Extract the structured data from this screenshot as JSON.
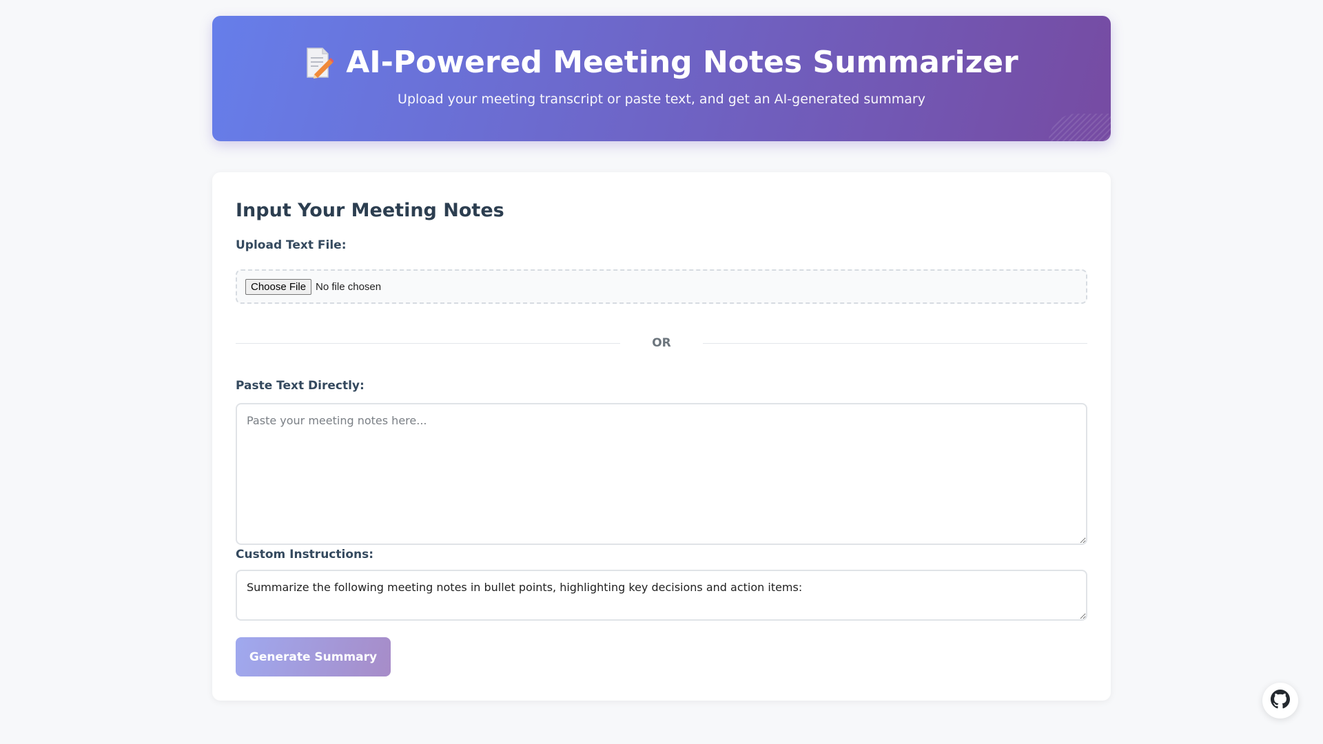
{
  "header": {
    "icon": "memo-icon",
    "title": "AI-Powered Meeting Notes Summarizer",
    "subtitle": "Upload your meeting transcript or paste text, and get an AI-generated summary",
    "gradient_start": "#667eea",
    "gradient_end": "#764ba2"
  },
  "input_card": {
    "title": "Input Your Meeting Notes",
    "upload_label": "Upload Text File:",
    "choose_file_label": "Choose File",
    "no_file_text": "No file chosen",
    "or_text": "OR",
    "paste_label": "Paste Text Directly:",
    "paste_placeholder": "Paste your meeting notes here...",
    "paste_value": "",
    "instructions_label": "Custom Instructions:",
    "instructions_value": "Summarize the following meeting notes in bullet points, highlighting key decisions and action items:",
    "generate_label": "Generate Summary"
  },
  "floating": {
    "github_icon": "github-icon"
  }
}
